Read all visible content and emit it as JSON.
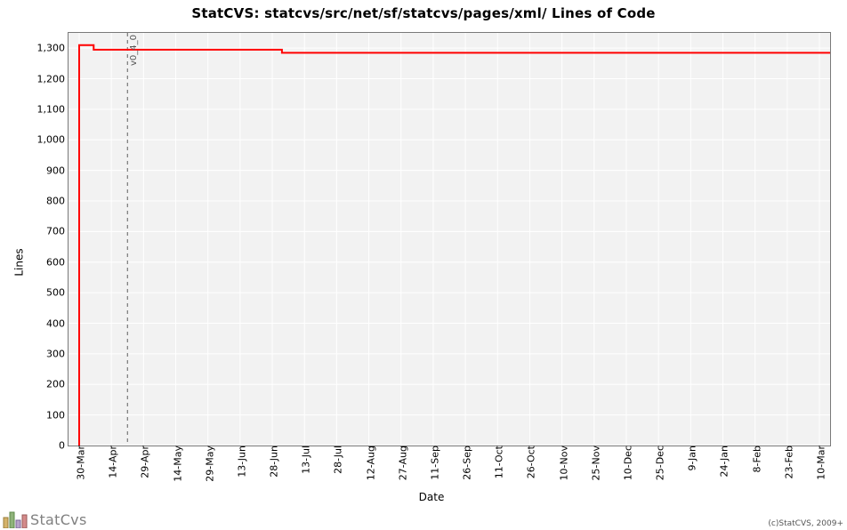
{
  "title": "StatCVS: statcvs/src/net/sf/statcvs/pages/xml/ Lines of Code",
  "xlabel": "Date",
  "ylabel": "Lines",
  "logo_text": "StatCvs",
  "credit": "(c)StatCVS, 2009+",
  "y_ticks": [
    0,
    100,
    200,
    300,
    400,
    500,
    600,
    700,
    800,
    900,
    1000,
    1100,
    1200,
    1300
  ],
  "y_tick_labels": [
    "0",
    "100",
    "200",
    "300",
    "400",
    "500",
    "600",
    "700",
    "800",
    "900",
    "1,000",
    "1,100",
    "1,200",
    "1,300"
  ],
  "x_ticks": [
    "30-Mar",
    "14-Apr",
    "29-Apr",
    "14-May",
    "29-May",
    "13-Jun",
    "28-Jun",
    "13-Jul",
    "28-Jul",
    "12-Aug",
    "27-Aug",
    "11-Sep",
    "26-Sep",
    "11-Oct",
    "26-Oct",
    "10-Nov",
    "25-Nov",
    "10-Dec",
    "25-Dec",
    "9-Jan",
    "24-Jan",
    "8-Feb",
    "23-Feb",
    "10-Mar"
  ],
  "vline": {
    "x_index": 1.5,
    "label": "v0_4_0"
  },
  "chart_data": {
    "type": "line",
    "title": "StatCVS: statcvs/src/net/sf/statcvs/pages/xml/ Lines of Code",
    "xlabel": "Date",
    "ylabel": "Lines",
    "ylim": [
      0,
      1350
    ],
    "categories": [
      "30-Mar",
      "14-Apr",
      "29-Apr",
      "14-May",
      "29-May",
      "13-Jun",
      "28-Jun",
      "13-Jul",
      "28-Jul",
      "12-Aug",
      "27-Aug",
      "11-Sep",
      "26-Sep",
      "11-Oct",
      "26-Oct",
      "10-Nov",
      "25-Nov",
      "10-Dec",
      "25-Dec",
      "9-Jan",
      "24-Jan",
      "8-Feb",
      "23-Feb",
      "10-Mar"
    ],
    "series": [
      {
        "name": "Lines of Code",
        "color": "#ff0000",
        "points": [
          {
            "x": "30-Mar",
            "y": 0
          },
          {
            "x": "30-Mar",
            "y": 1310
          },
          {
            "x": "06-Apr",
            "y": 1310
          },
          {
            "x": "06-Apr",
            "y": 1295
          },
          {
            "x": "02-Jul",
            "y": 1295
          },
          {
            "x": "02-Jul",
            "y": 1285
          },
          {
            "x": "15-Mar",
            "y": 1285
          }
        ]
      }
    ],
    "annotations": [
      {
        "type": "vline",
        "x": "21-Apr",
        "label": "v0_4_0",
        "style": "dashed"
      }
    ]
  }
}
